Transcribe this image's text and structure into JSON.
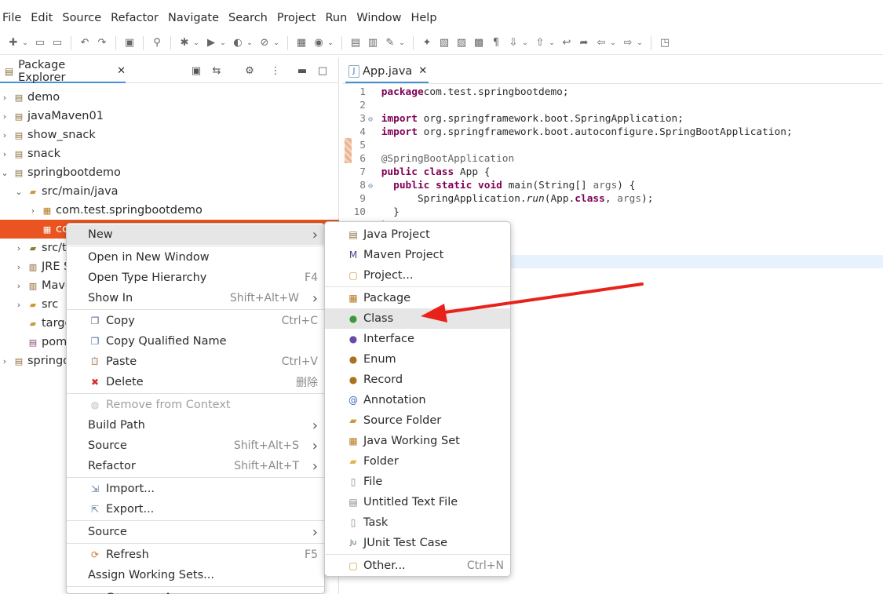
{
  "menubar": [
    "File",
    "Edit",
    "Source",
    "Refactor",
    "Navigate",
    "Search",
    "Project",
    "Run",
    "Window",
    "Help"
  ],
  "package_explorer": {
    "tab_label": "Package Explorer",
    "tree": [
      {
        "label": "demo"
      },
      {
        "label": "javaMaven01"
      },
      {
        "label": "show_snack"
      },
      {
        "label": "snack"
      },
      {
        "label": "springbootdemo"
      },
      {
        "label": "src/main/java"
      },
      {
        "label": "com.test.springbootdemo"
      },
      {
        "label": "co"
      },
      {
        "label": "src/t"
      },
      {
        "label": "JRE S"
      },
      {
        "label": "Mave"
      },
      {
        "label": "src"
      },
      {
        "label": "targe"
      },
      {
        "label": "pom"
      },
      {
        "label": "springd"
      }
    ]
  },
  "editor": {
    "tab_label": "App.java",
    "lines": [
      {
        "n": "1",
        "segs": [
          [
            "kw",
            "package"
          ],
          [
            "",
            "com.test.springbootdemo;"
          ]
        ]
      },
      {
        "n": "2",
        "segs": []
      },
      {
        "n": "3",
        "fold": "⊖",
        "segs": [
          [
            "kw",
            "import"
          ],
          [
            "",
            " org.springframework.boot.SpringApplication;"
          ]
        ]
      },
      {
        "n": "4",
        "segs": [
          [
            "kw",
            "import"
          ],
          [
            "",
            " org.springframework.boot.autoconfigure.SpringBootApplication;"
          ]
        ]
      },
      {
        "n": "5",
        "segs": []
      },
      {
        "n": "6",
        "segs": [
          [
            "ann",
            "@SpringBootApplication"
          ]
        ]
      },
      {
        "n": "7",
        "segs": [
          [
            "kw",
            "public"
          ],
          [
            "",
            " "
          ],
          [
            "kw",
            "class"
          ],
          [
            "",
            " App {"
          ]
        ]
      },
      {
        "n": "8",
        "fold": "⊖",
        "segs": [
          [
            "",
            "  "
          ],
          [
            "kw",
            "public"
          ],
          [
            "",
            " "
          ],
          [
            "kw",
            "static"
          ],
          [
            "",
            " "
          ],
          [
            "kw",
            "void"
          ],
          [
            "",
            " main(String[] "
          ],
          [
            "ann",
            "args"
          ],
          [
            "",
            ") {"
          ]
        ]
      },
      {
        "n": "9",
        "segs": [
          [
            "",
            "      SpringApplication."
          ],
          [
            "it",
            "run"
          ],
          [
            "",
            "(App."
          ],
          [
            "kw",
            "class"
          ],
          [
            "",
            ", "
          ],
          [
            "ann",
            "args"
          ],
          [
            "",
            ");"
          ]
        ]
      },
      {
        "n": "10",
        "segs": [
          [
            "",
            "  }"
          ]
        ]
      },
      {
        "n": "",
        "segs": [
          [
            "",
            "}"
          ]
        ]
      }
    ]
  },
  "context_menu": [
    {
      "label": "New",
      "sub": true,
      "hl": true
    },
    {
      "sep": true
    },
    {
      "label": "Open in New Window"
    },
    {
      "label": "Open Type Hierarchy",
      "sc": "F4"
    },
    {
      "label": "Show In",
      "sc": "Shift+Alt+W",
      "sub": true
    },
    {
      "sep": true
    },
    {
      "label": "Copy",
      "sc": "Ctrl+C",
      "icon": "copy-icon"
    },
    {
      "label": "Copy Qualified Name",
      "icon": "copy-icon"
    },
    {
      "label": "Paste",
      "sc": "Ctrl+V",
      "icon": "paste-icon"
    },
    {
      "label": "Delete",
      "sc": "删除",
      "icon": "delete-icon"
    },
    {
      "sep": true
    },
    {
      "label": "Remove from Context",
      "dis": true,
      "icon": "remove-context-icon"
    },
    {
      "label": "Build Path",
      "sub": true
    },
    {
      "label": "Source",
      "sc": "Shift+Alt+S",
      "sub": true
    },
    {
      "label": "Refactor",
      "sc": "Shift+Alt+T",
      "sub": true
    },
    {
      "sep": true
    },
    {
      "label": "Import...",
      "icon": "import-icon"
    },
    {
      "label": "Export...",
      "icon": "export-icon"
    },
    {
      "sep": true
    },
    {
      "label": "Source",
      "sub": true
    },
    {
      "sep": true
    },
    {
      "label": "Refresh",
      "sc": "F5",
      "icon": "refresh-icon"
    },
    {
      "label": "Assign Working Sets..."
    },
    {
      "sep": true
    },
    {
      "label": "Coverage As",
      "sub": true,
      "icon": "coverage-icon"
    }
  ],
  "submenu": [
    {
      "label": "Java Project",
      "icon": "java-project-icon"
    },
    {
      "label": "Maven Project",
      "icon": "maven-project-icon"
    },
    {
      "label": "Project...",
      "icon": "project-icon"
    },
    {
      "sep": true
    },
    {
      "label": "Package",
      "icon": "package-icon"
    },
    {
      "label": "Class",
      "icon": "class-icon",
      "hl": true
    },
    {
      "label": "Interface",
      "icon": "interface-icon"
    },
    {
      "label": "Enum",
      "icon": "enum-icon"
    },
    {
      "label": "Record",
      "icon": "record-icon"
    },
    {
      "label": "Annotation",
      "icon": "annotation-icon"
    },
    {
      "label": "Source Folder",
      "icon": "source-folder-icon"
    },
    {
      "label": "Java Working Set",
      "icon": "working-set-icon"
    },
    {
      "label": "Folder",
      "icon": "folder-icon"
    },
    {
      "label": "File",
      "icon": "file-icon"
    },
    {
      "label": "Untitled Text File",
      "icon": "text-file-icon"
    },
    {
      "label": "Task",
      "icon": "task-icon"
    },
    {
      "label": "JUnit Test Case",
      "icon": "junit-icon"
    },
    {
      "sep": true
    },
    {
      "label": "Other...",
      "sc": "Ctrl+N",
      "icon": "other-icon"
    }
  ],
  "colors": {
    "selection": "#e95420",
    "arrow": "#e8221b",
    "keyword": "#7f0055"
  }
}
